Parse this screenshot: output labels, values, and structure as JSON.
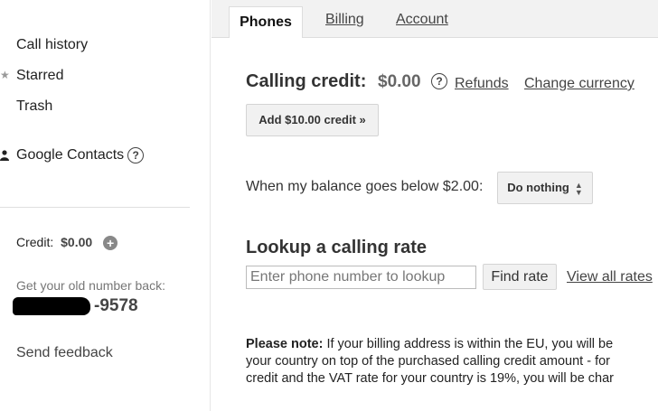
{
  "sidebar": {
    "items": [
      {
        "label": "Call history"
      },
      {
        "label": "Starred"
      },
      {
        "label": "Trash"
      }
    ],
    "contacts_label": "Google Contacts",
    "credit_label": "Credit:",
    "credit_amount": "$0.00",
    "old_number_label": "Get your old number back:",
    "old_number_suffix": "-9578",
    "feedback_label": "Send feedback"
  },
  "tabs": [
    {
      "label": "Phones",
      "active": true
    },
    {
      "label": "Billing"
    },
    {
      "label": "Account"
    }
  ],
  "credit": {
    "title": "Calling credit:",
    "amount": "$0.00",
    "refunds_label": "Refunds",
    "change_currency_label": "Change currency",
    "add_button_label": "Add $10.00 credit »"
  },
  "balance": {
    "label": "When my balance goes below $2.00:",
    "select_value": "Do nothing"
  },
  "lookup": {
    "title": "Lookup a calling rate",
    "placeholder": "Enter phone number to lookup",
    "find_button_label": "Find rate",
    "view_all_label": "View all rates"
  },
  "note": {
    "bold": "Please note:",
    "line1": "If your billing address is within the EU, you will be",
    "line2": "your country on top of the purchased calling credit amount - for",
    "line3": "credit and the VAT rate for your country is 19%, you will be char"
  },
  "icons": {
    "help": "?",
    "plus": "+",
    "star": "★"
  }
}
